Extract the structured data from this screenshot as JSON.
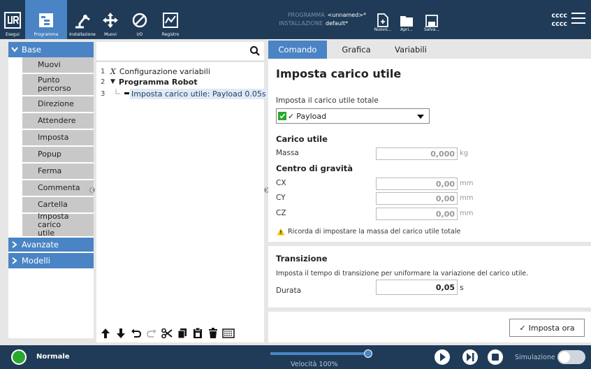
{
  "topbar": {
    "nav": [
      {
        "label": "Esegui",
        "icon": "ur-logo-icon"
      },
      {
        "label": "Programma",
        "icon": "program-icon",
        "active": true
      },
      {
        "label": "Installazione",
        "icon": "robot-arm-icon"
      },
      {
        "label": "Muovi",
        "icon": "move-icon"
      },
      {
        "label": "I/O",
        "icon": "io-icon"
      },
      {
        "label": "Registro",
        "icon": "log-icon"
      }
    ],
    "program_key": "PROGRAMMA",
    "program_value": "<unnamed>*",
    "installation_key": "INSTALLAZIONE",
    "installation_value": "default*",
    "file_buttons": [
      {
        "label": "Nuovo...",
        "icon": "new-file-icon"
      },
      {
        "label": "Apri...",
        "icon": "folder-icon"
      },
      {
        "label": "Salva...",
        "icon": "save-icon"
      }
    ],
    "robot_line1": "cccc",
    "robot_line2": "cccc"
  },
  "leftnav": {
    "base_label": "Base",
    "items": [
      "Muovi",
      "Punto percorso",
      "Direzione",
      "Attendere",
      "Imposta",
      "Popup",
      "Ferma",
      "Commenta",
      "Cartella",
      "Imposta carico utile"
    ],
    "advanced_label": "Avanzate",
    "models_label": "Modelli"
  },
  "tree": {
    "search_placeholder": "",
    "lines": [
      {
        "num": "1",
        "symbol": "X",
        "text": "Configurazione variabili"
      },
      {
        "num": "2",
        "symbol": "▼",
        "text": "Programma Robot"
      },
      {
        "num": "3",
        "symbol": "",
        "text": "Imposta carico utile: Payload 0.05s"
      }
    ]
  },
  "tabs": [
    "Comando",
    "Grafica",
    "Variabili"
  ],
  "command": {
    "title": "Imposta carico utile",
    "total_payload_label": "Imposta il carico utile totale",
    "payload_selected": "Payload",
    "payload_section": "Carico utile",
    "mass_label": "Massa",
    "mass_value": "0,000",
    "mass_unit": "kg",
    "cog_section": "Centro di gravità",
    "cx_label": "CX",
    "cx_value": "0,00",
    "cy_label": "CY",
    "cy_value": "0,00",
    "cz_label": "CZ",
    "cz_value": "0,00",
    "length_unit": "mm",
    "warning_text": "Ricorda di impostare la massa del carico utile totale",
    "transition_section": "Transizione",
    "transition_desc": "Imposta il tempo di transizione per uniformare la variazione del carico utile.",
    "duration_label": "Durata",
    "duration_value": "0,05",
    "duration_unit": "s",
    "set_now_label": "Imposta ora"
  },
  "footer": {
    "status_label": "Normale",
    "speed_label": "Velocità 100%",
    "speed_fraction": 1.0,
    "sim_label": "Simulazione",
    "sim_on": false
  },
  "colors": {
    "topbar": "#1f3b58",
    "accent": "#4a84c4",
    "status_green": "#28a82e"
  }
}
